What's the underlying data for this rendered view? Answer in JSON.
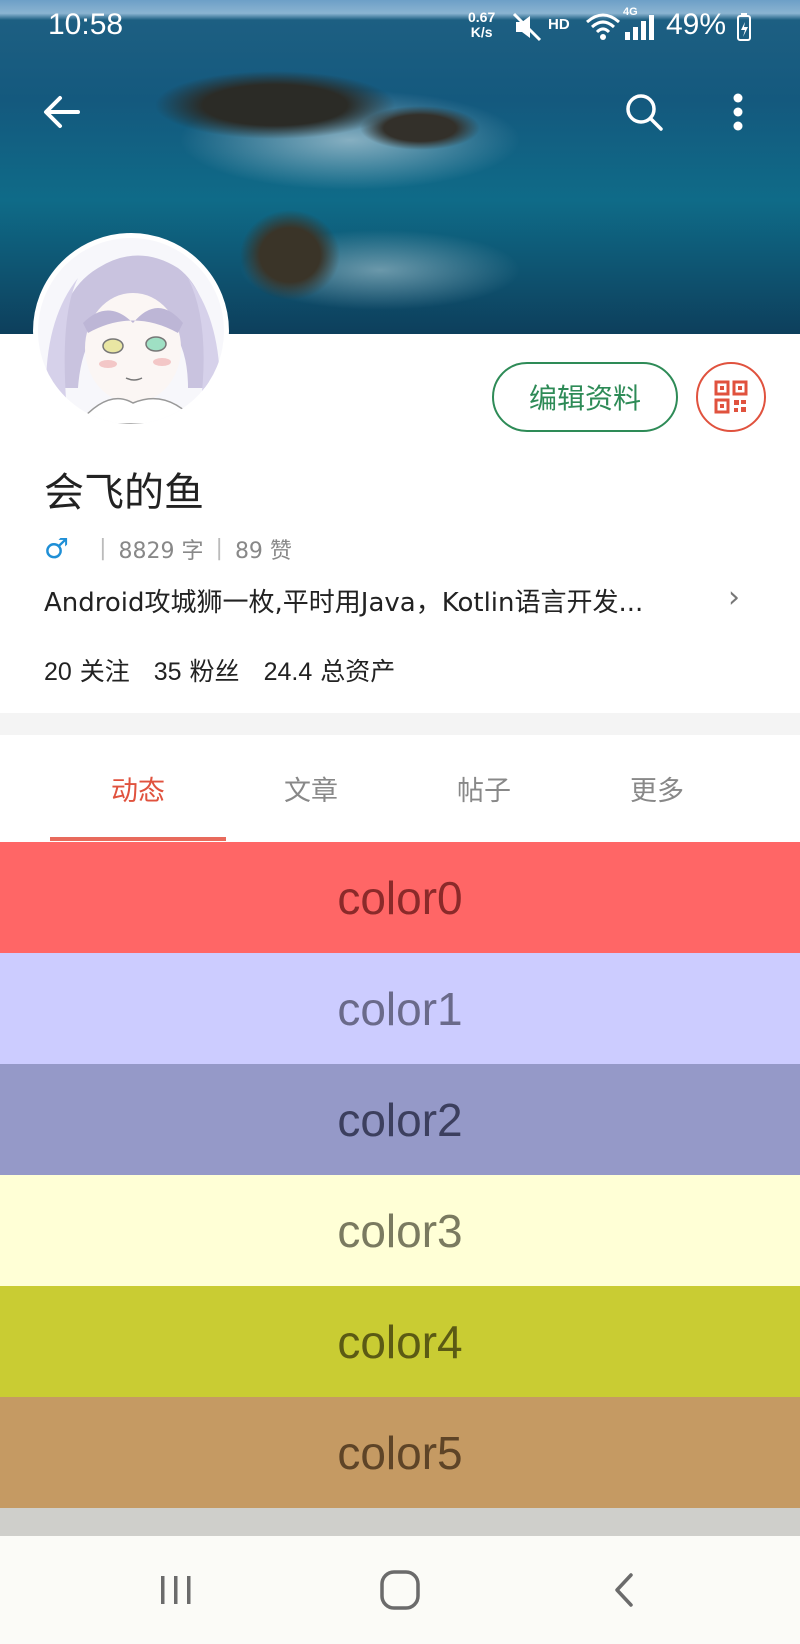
{
  "status": {
    "time": "10:58",
    "speed_value": "0.67",
    "speed_unit": "K/s",
    "hd": "HD",
    "network": "4G",
    "battery": "49%"
  },
  "profile": {
    "username": "会飞的鱼",
    "gender_symbol": "♂",
    "words": "8829 字",
    "likes": "89 赞",
    "bio": "Android攻城狮一枚,平时用Java，Kotlin语言开发...",
    "edit_label": "编辑资料",
    "following_count": "20",
    "following_label": "关注",
    "followers_count": "35",
    "followers_label": "粉丝",
    "assets_count": "24.4",
    "assets_label": "总资产"
  },
  "tabs": [
    {
      "label": "动态",
      "active": true
    },
    {
      "label": "文章",
      "active": false
    },
    {
      "label": "帖子",
      "active": false
    },
    {
      "label": "更多",
      "active": false
    }
  ],
  "color_items": [
    {
      "label": "color0",
      "bg": "#ff6666",
      "fg": "#8a2a2a"
    },
    {
      "label": "color1",
      "bg": "#ccccff",
      "fg": "#6a6a8a"
    },
    {
      "label": "color2",
      "bg": "#9599c8",
      "fg": "#3c3f5e"
    },
    {
      "label": "color3",
      "bg": "#ffffd6",
      "fg": "#7a7a60"
    },
    {
      "label": "color4",
      "bg": "#c9cc33",
      "fg": "#5b5a14"
    },
    {
      "label": "color5",
      "bg": "#c59a63",
      "fg": "#5e4427"
    }
  ],
  "icons": {
    "back": "back-arrow-icon",
    "search": "search-icon",
    "more": "more-vert-icon",
    "qr": "qr-code-icon",
    "chevron": "chevron-right-icon"
  },
  "accent": {
    "green": "#2e8b57",
    "red": "#e0523e"
  }
}
